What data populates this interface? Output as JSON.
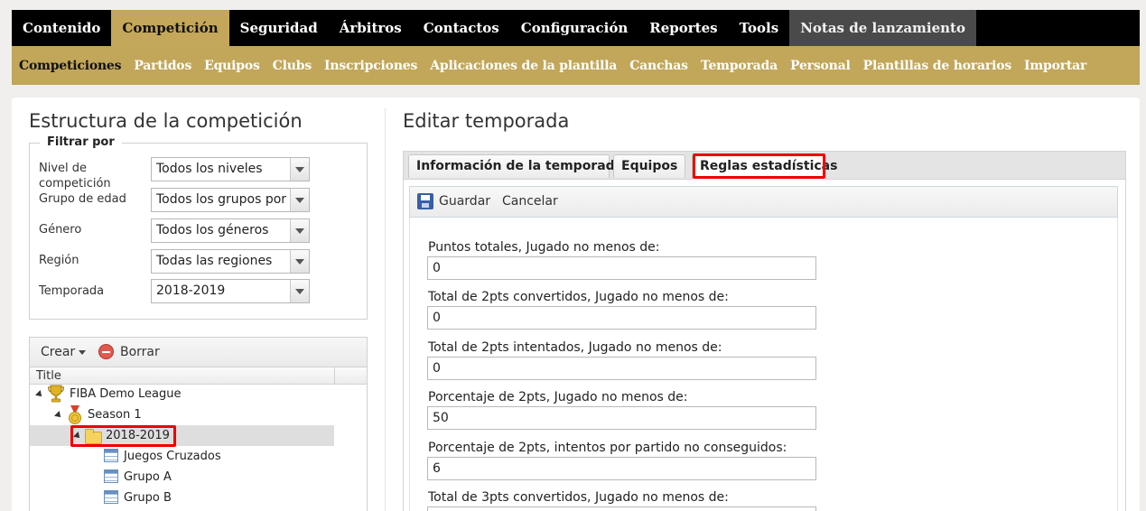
{
  "topnav": [
    "Contenido",
    "Competición",
    "Seguridad",
    "Árbitros",
    "Contactos",
    "Configuración",
    "Reportes",
    "Tools",
    "Notas de lanzamiento"
  ],
  "subnav": [
    "Competiciones",
    "Partidos",
    "Equipos",
    "Clubs",
    "Inscripciones",
    "Aplicaciones de la plantilla",
    "Canchas",
    "Temporada",
    "Personal",
    "Plantillas de horarios",
    "Importar"
  ],
  "left": {
    "title": "Estructura de la competición",
    "filter_legend": "Filtrar por",
    "filters": [
      {
        "label": "Nivel de competición",
        "value": "Todos los niveles"
      },
      {
        "label": "Grupo de edad",
        "value": "Todos los grupos por"
      },
      {
        "label": "Género",
        "value": "Todos los géneros"
      },
      {
        "label": "Región",
        "value": "Todas las regiones"
      },
      {
        "label": "Temporada",
        "value": "2018-2019"
      }
    ],
    "toolbar": {
      "create": "Crear",
      "delete": "Borrar"
    },
    "tree_header": "Title",
    "tree": {
      "league": "FIBA Demo League",
      "season": "Season 1",
      "year": "2018-2019",
      "children": [
        "Juegos Cruzados",
        "Grupo A",
        "Grupo B"
      ]
    }
  },
  "right": {
    "title": "Editar temporada",
    "tabs": [
      "Información de la temporada",
      "Equipos",
      "Reglas estadísticas"
    ],
    "toolbar": {
      "save": "Guardar",
      "cancel": "Cancelar"
    },
    "fields": [
      {
        "label": "Puntos totales, Jugado no menos de:",
        "value": "0"
      },
      {
        "label": "Total de 2pts convertidos, Jugado no menos de:",
        "value": "0"
      },
      {
        "label": "Total de 2pts intentados, Jugado no menos de:",
        "value": "0"
      },
      {
        "label": "Porcentaje de 2pts, Jugado no menos de:",
        "value": "50"
      },
      {
        "label": "Porcentaje de 2pts, intentos por partido no conseguidos:",
        "value": "6"
      },
      {
        "label": "Total de 3pts convertidos, Jugado no menos de:",
        "value": ""
      }
    ]
  },
  "colors": {
    "accent": "#c2a659",
    "nav_bg": "#000000",
    "highlight": "#e00000"
  }
}
